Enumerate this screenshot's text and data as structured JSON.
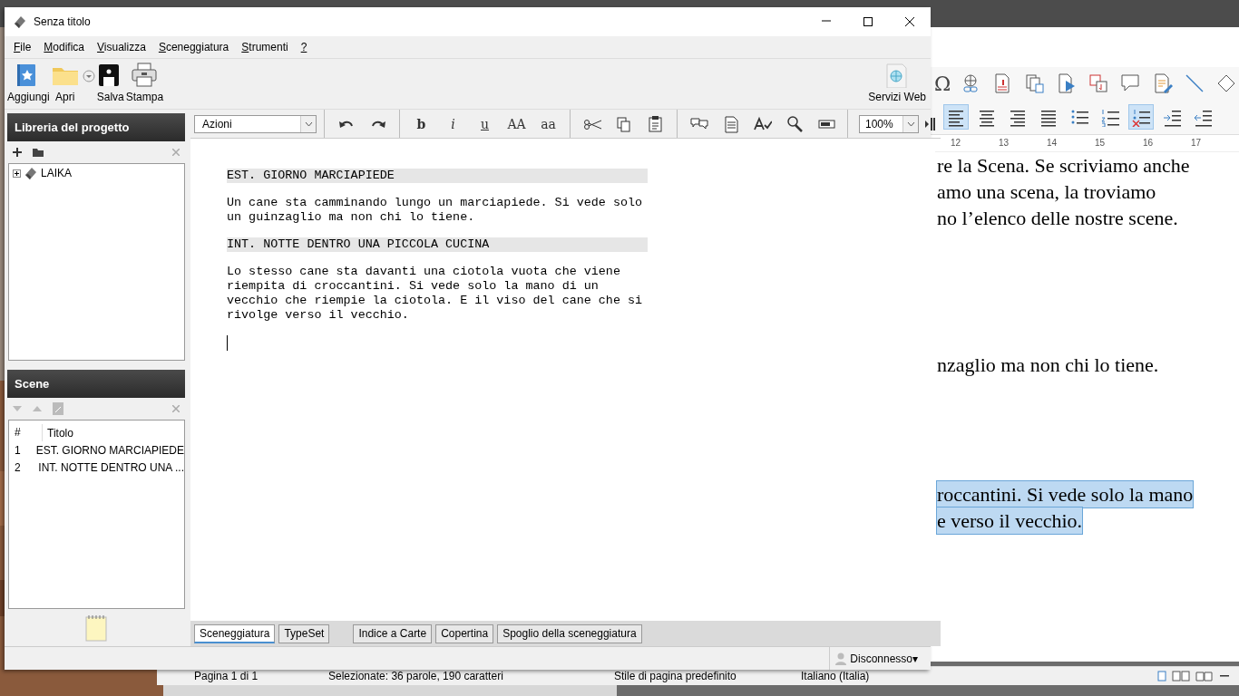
{
  "background_window": {
    "toolbar_row_1": [
      {
        "kind": "omega",
        "label": "Ω"
      },
      {
        "kind": "link"
      },
      {
        "kind": "footnote"
      },
      {
        "kind": "pages"
      },
      {
        "kind": "pageplay"
      },
      {
        "kind": "crossref"
      },
      {
        "kind": "comment"
      },
      {
        "kind": "edit"
      },
      {
        "kind": "line"
      },
      {
        "kind": "diamond"
      }
    ],
    "toolbar_row_2": [
      {
        "kind": "alignleft",
        "selected": true
      },
      {
        "kind": "aligncenter",
        "selected": false
      },
      {
        "kind": "alignright",
        "selected": false
      },
      {
        "kind": "justify",
        "selected": false
      },
      {
        "kind": "bullets",
        "selected": false
      },
      {
        "kind": "numbers",
        "selected": false
      },
      {
        "kind": "nolist",
        "selected": true
      },
      {
        "kind": "indent",
        "selected": false
      },
      {
        "kind": "outdent",
        "selected": false
      }
    ],
    "ruler": [
      "12",
      "13",
      "14",
      "15",
      "16",
      "17"
    ],
    "text_lines": [
      {
        "text": "re la Scena. Se scriviamo anche",
        "selected": false
      },
      {
        "text": "amo una scena, la troviamo",
        "selected": false
      },
      {
        "text": "no l’elenco delle nostre scene.",
        "selected": false
      },
      {
        "text": "nzaglio ma non chi lo tiene.",
        "selected": false
      },
      {
        "text": "roccantini. Si vede solo la mano",
        "selected": true
      },
      {
        "text": "e verso il vecchio.",
        "selected": true
      }
    ],
    "status_bar": [
      "Pagina 1 di 1",
      "Selezionate: 36 parole, 190 caratteri",
      "Stile di pagina predefinito",
      "Italiano (Italia)"
    ]
  },
  "window": {
    "title": "Senza titolo"
  },
  "menu": [
    "File",
    "Modifica",
    "Visualizza",
    "Sceneggiatura",
    "Strumenti",
    "?"
  ],
  "toolbar": [
    {
      "kind": "add",
      "label": "Aggiungi"
    },
    {
      "kind": "open",
      "label": "Apri"
    },
    {
      "kind": "dropdown"
    },
    {
      "kind": "save",
      "label": "Salva"
    },
    {
      "kind": "print",
      "label": "Stampa"
    },
    {
      "kind": "web",
      "label": "Servizi Web"
    }
  ],
  "library": {
    "title": "Libreria del progetto",
    "tree": [
      {
        "label": "LAIKA",
        "expanded": false
      }
    ]
  },
  "scenes": {
    "title": "Scene",
    "columns": [
      "#",
      "Titolo"
    ],
    "rows": [
      [
        "1",
        "EST. GIORNO MARCIAPIEDE"
      ],
      [
        "2",
        "INT. NOTTE DENTRO UNA ..."
      ]
    ]
  },
  "format_toolbar": {
    "actions": "Azioni",
    "zoom": "100%",
    "groups": [
      [
        {
          "kind": "undo"
        },
        {
          "kind": "redo"
        }
      ],
      [
        {
          "kind": "bold",
          "label": "b"
        },
        {
          "kind": "italic",
          "label": "i"
        },
        {
          "kind": "underline",
          "label": "u"
        },
        {
          "kind": "upper",
          "label": "AA"
        },
        {
          "kind": "lower",
          "label": "aa"
        }
      ],
      [
        {
          "kind": "cut"
        },
        {
          "kind": "copy"
        },
        {
          "kind": "paste"
        }
      ],
      [
        {
          "kind": "note"
        },
        {
          "kind": "document"
        },
        {
          "kind": "spell"
        },
        {
          "kind": "find"
        },
        {
          "kind": "field"
        }
      ]
    ]
  },
  "script": [
    {
      "kind": "heading",
      "text": "EST. GIORNO MARCIAPIEDE"
    },
    {
      "kind": "action",
      "text": "Un cane sta camminando lungo un marciapiede. Si vede solo un guinzaglio ma non chi lo tiene."
    },
    {
      "kind": "heading",
      "text": "INT. NOTTE DENTRO UNA PICCOLA CUCINA"
    },
    {
      "kind": "action",
      "text": "Lo stesso cane sta davanti una ciotola vuota che viene riempita di croccantini. Si vede solo la mano di un vecchio che riempie la ciotola. E il viso del cane che si rivolge verso il vecchio."
    }
  ],
  "tabs": [
    {
      "label": "Sceneggiatura",
      "selected": true
    },
    {
      "label": "TypeSet",
      "selected": false
    },
    {
      "label": "Indice a Carte",
      "selected": false
    },
    {
      "label": "Copertina",
      "selected": false
    },
    {
      "label": "Spoglio della sceneggiatura",
      "selected": false
    }
  ],
  "connection": "Disconnesso▾"
}
